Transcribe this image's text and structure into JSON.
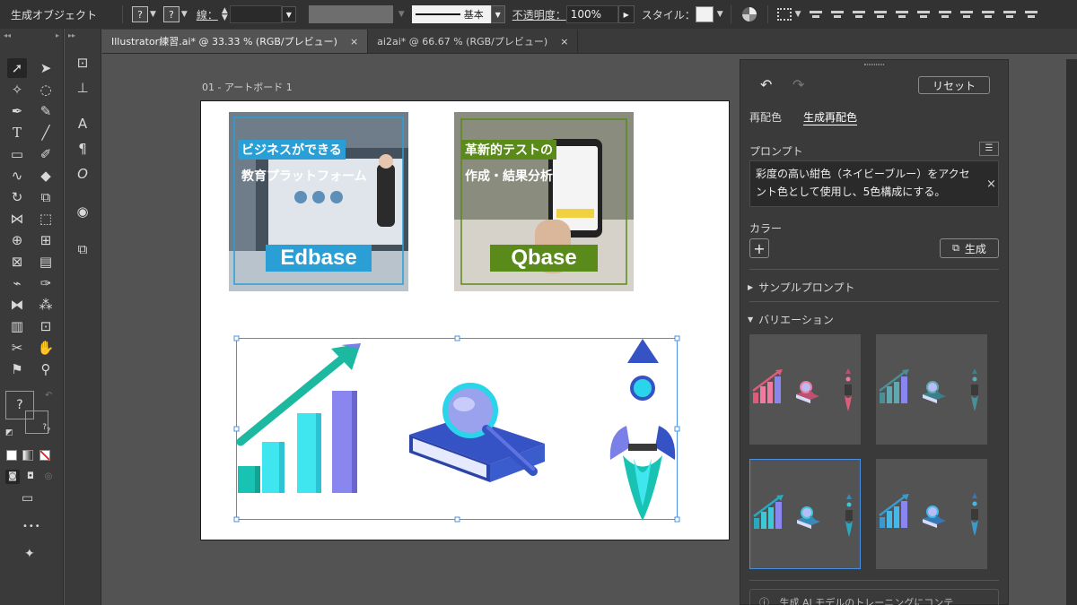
{
  "control_bar": {
    "title": "生成オブジェクト",
    "fill_placeholder": "?",
    "stroke_placeholder": "?",
    "stroke_label": "線：",
    "brush_label": "基本",
    "opacity_label": "不透明度：",
    "opacity_value": "100%",
    "style_label": "スタイル："
  },
  "tabs": [
    {
      "label": "Illustrator練習.ai* @ 33.33 % (RGB/プレビュー)",
      "close": "×",
      "active": true
    },
    {
      "label": "ai2ai* @ 66.67 % (RGB/プレビュー)",
      "close": "×",
      "active": false
    }
  ],
  "tools": {
    "swatch_question": "?",
    "swatch_small_q1": "?",
    "swatch_small_q2": "?",
    "more": "•••"
  },
  "artboard": {
    "label": "01 - アートボード 1",
    "cards": [
      {
        "line1": "ビジネスができる",
        "line2": "教育プラットフォーム",
        "logo": "Edbase",
        "accent": "#2a9fd6"
      },
      {
        "line1": "革新的テストの",
        "line2": "作成・結果分析",
        "logo": "Qbase",
        "accent": "#5a8a1a"
      }
    ]
  },
  "panel": {
    "reset": "リセット",
    "tab_recolor": "再配色",
    "tab_gen_recolor": "生成再配色",
    "prompt_label": "プロンプト",
    "prompt_text": "彩度の高い紺色（ネイビーブルー）をアクセント色として使用し、5色構成にする。",
    "prompt_clear": "×",
    "color_label": "カラー",
    "add": "+",
    "generate": "生成",
    "sample_prompt": "サンプルプロンプト",
    "variations": "バリエーション",
    "footer_text": "生成 AI モデルのトレーニングにコンテ",
    "variation_colors": [
      {
        "bar": "#f07aa0",
        "accent": "#e05a7a",
        "book": "#c05070"
      },
      {
        "bar": "#5fa8b0",
        "accent": "#4a8e98",
        "book": "#3a7f8a"
      },
      {
        "bar": "#3cc8d8",
        "accent": "#2aa8c0",
        "book": "#3a8ab8"
      },
      {
        "bar": "#46b8e8",
        "accent": "#3a9ad0",
        "book": "#3478b8"
      }
    ]
  },
  "colors": {
    "app_bg": "#535353",
    "panel_bg": "#3a3a3a",
    "selection": "#4a90e2",
    "icon_teal": "#19c3b3",
    "icon_cyan": "#3fe6f0",
    "icon_violet": "#7b7fe8",
    "icon_blue": "#3553c4"
  }
}
